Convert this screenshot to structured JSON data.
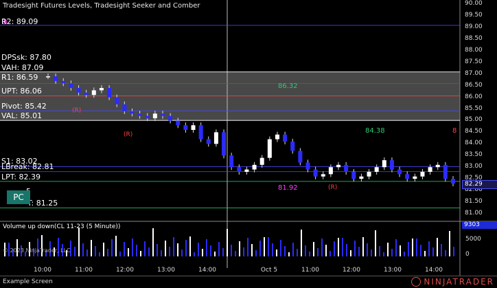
{
  "chart_title": "Tradesight Futures Levels, Tradesight Seeker and Comber",
  "levels": [
    {
      "label": "R2: 89.09",
      "price": 89.09,
      "color": "#4a4aff"
    },
    {
      "label": "VAH: 87.09",
      "price": 87.09,
      "color": "#ffffff"
    },
    {
      "label": "R1: 86.59",
      "price": 86.59,
      "color": "#4a4aff"
    },
    {
      "label": "UPT: 86.06",
      "price": 86.06,
      "color": "#ff4040"
    },
    {
      "label": "Pivot: 85.42",
      "price": 85.42,
      "color": "#4a4aff"
    },
    {
      "label": "VAL: 85.01",
      "price": 85.01,
      "color": "#ffffff"
    },
    {
      "label": "S1: 83.02",
      "price": 83.02,
      "color": "#4a4aff"
    },
    {
      "label": "LBreak: 82.81",
      "price": 82.81,
      "color": "#4a4aff"
    },
    {
      "label": "LPT: 82.39",
      "price": 82.39,
      "color": "#2ecc71"
    },
    {
      "label": "81.25",
      "price": 81.25,
      "color": "#2ecc71"
    }
  ],
  "overlap_labels": [
    "DPSsk: 87.80",
    "5",
    "T: 81.25"
  ],
  "pc_button": "PC",
  "price_axis": {
    "min": 81.0,
    "max": 90.0,
    "ticks": [
      "90.00",
      "89.50",
      "89.00",
      "88.50",
      "88.00",
      "87.50",
      "87.00",
      "86.50",
      "86.00",
      "85.50",
      "85.00",
      "84.50",
      "84.00",
      "83.50",
      "83.00",
      "82.50",
      "82.00",
      "81.50",
      "81.00"
    ]
  },
  "current_price": "82.29",
  "inline_labels": [
    {
      "text": "86.32",
      "color": "#2ecc71"
    },
    {
      "text": "84.38",
      "color": "#2ecc71"
    },
    {
      "text": "81.92",
      "color": "#ff40ff"
    },
    {
      "text": "(R)",
      "color": "#ff4040"
    },
    {
      "text": "(R)",
      "color": "#ff4040"
    },
    {
      "text": "(R)",
      "color": "#ff4040"
    },
    {
      "text": "8",
      "color": "#ff4040"
    }
  ],
  "volume": {
    "title": "Volume up down(CL 11-23 (5 Minute))",
    "axis": [
      "5000",
      "0"
    ],
    "last": "9303"
  },
  "copyright": "© 2023 NinjaTrader, LLC",
  "time_axis": [
    "10:00",
    "11:00",
    "12:00",
    "13:00",
    "14:00",
    "Oct 5",
    "11:00",
    "12:00",
    "13:00",
    "14:00"
  ],
  "bottom_tab": "Example Screen",
  "brand": "NINJATRADER",
  "chart_data": {
    "type": "candlestick",
    "title": "Tradesight Futures Levels, Tradesight Seeker and Comber",
    "ylim": [
      81.0,
      90.0
    ],
    "x": [
      "10:00",
      "11:00",
      "12:00",
      "13:00",
      "14:00",
      "Oct 5",
      "11:00",
      "12:00",
      "13:00",
      "14:00"
    ],
    "series": [
      {
        "name": "Volume up down(CL 11-23 (5 Minute))",
        "values": []
      }
    ]
  }
}
